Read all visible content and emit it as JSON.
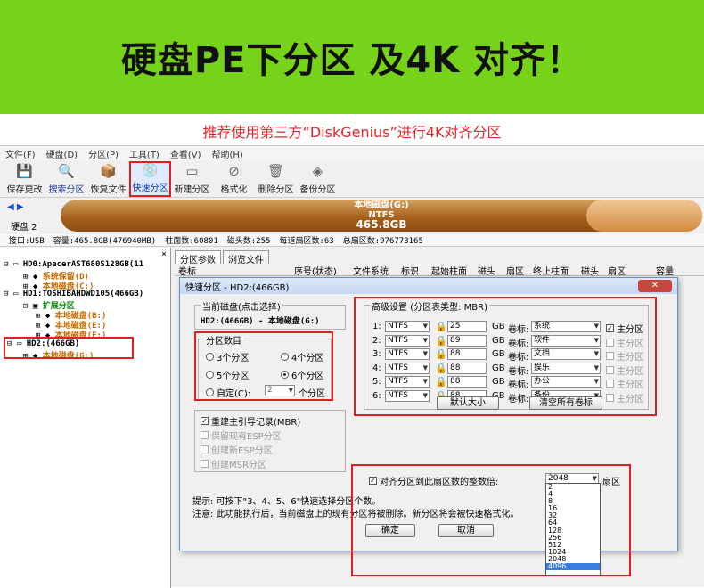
{
  "banner": {
    "title": "硬盘PE下分区 及4K 对齐！"
  },
  "subtitle": "推荐使用第三方“DiskGenius”进行4K对齐分区",
  "menu": [
    "文件(F)",
    "硬盘(D)",
    "分区(P)",
    "工具(T)",
    "查看(V)",
    "帮助(H)"
  ],
  "toolbar": [
    {
      "label": "保存更改",
      "icon": "save-icon",
      "glyph": "💾"
    },
    {
      "label": "搜索分区",
      "icon": "search-icon",
      "glyph": "🔍"
    },
    {
      "label": "恢复文件",
      "icon": "restore-icon",
      "glyph": "📦"
    },
    {
      "label": "快速分区",
      "icon": "quick-partition-icon",
      "glyph": "💿"
    },
    {
      "label": "新建分区",
      "icon": "new-partition-icon",
      "glyph": "▭"
    },
    {
      "label": "格式化",
      "icon": "format-icon",
      "glyph": "⊘"
    },
    {
      "label": "删除分区",
      "icon": "delete-icon",
      "glyph": "🗑"
    },
    {
      "label": "备份分区",
      "icon": "backup-icon",
      "glyph": "◈"
    }
  ],
  "disk": {
    "nav": "◀ ▶",
    "label": "硬盘 2",
    "vol_name": "本地磁盘(G:)",
    "fs": "NTFS",
    "size": "465.8GB"
  },
  "info": {
    "iface": "接口:USB",
    "capacity": "容量:465.8GB(476940MB)",
    "cylinders": "柱面数:60801",
    "heads": "磁头数:255",
    "sectors": "每道扇区数:63",
    "total": "总扇区数:976773165"
  },
  "tree": {
    "close": "×",
    "hd0": "HD0:ApacerAST680S128GB(11",
    "hd0_p1": "系统保留(D)",
    "hd0_p2": "本地磁盘(C:)",
    "hd1": "HD1:TOSHIBAHDWD105(466GB)",
    "hd1_ext": "扩展分区",
    "hd1_p1": "本地磁盘(B:)",
    "hd1_p2": "本地磁盘(E:)",
    "hd1_p3": "本地磁盘(F:)",
    "hd2": "HD2:(466GB)",
    "hd2_p1": "本地磁盘(G:)"
  },
  "tabs": [
    "分区参数",
    "浏览文件"
  ],
  "columns": [
    "卷标",
    "序号(状态)",
    "文件系统",
    "标识",
    "起始柱面",
    "磁头",
    "扇区",
    "终止柱面",
    "磁头",
    "扇区",
    "容量"
  ],
  "dialog": {
    "title": "快速分区 - HD2:(466GB)",
    "close": "✕",
    "current_disk_label": "当前磁盘(点击选择)",
    "current_disk": "HD2:(466GB) - 本地磁盘(G:)",
    "count_group": "分区数目",
    "opt3": "3个分区",
    "opt4": "4个分区",
    "opt5": "5个分区",
    "opt6": "6个分区",
    "custom": "自定(C):",
    "custom_value": "2",
    "custom_unit": "个分区",
    "rebuild_mbr": "重建主引导记录(MBR)",
    "keep_esp": "保留现有ESP分区",
    "new_esp": "创建新ESP分区",
    "new_msr": "创建MSR分区",
    "adv_group": "高级设置 (分区表类型: MBR)",
    "unit": "GB",
    "vol_label": "卷标:",
    "primary": "主分区",
    "rows": [
      {
        "no": "1:",
        "fs": "NTFS",
        "size": "25",
        "label": "系统",
        "primary": true
      },
      {
        "no": "2:",
        "fs": "NTFS",
        "size": "89",
        "label": "软件",
        "primary": false
      },
      {
        "no": "3:",
        "fs": "NTFS",
        "size": "88",
        "label": "文档",
        "primary": false
      },
      {
        "no": "4:",
        "fs": "NTFS",
        "size": "88",
        "label": "娱乐",
        "primary": false
      },
      {
        "no": "5:",
        "fs": "NTFS",
        "size": "88",
        "label": "办公",
        "primary": false
      },
      {
        "no": "6:",
        "fs": "NTFS",
        "size": "88",
        "label": "备份",
        "primary": false
      }
    ],
    "default_size_btn": "默认大小",
    "clear_labels_btn": "清空所有卷标",
    "align_label": "对齐分区到此扇区数的整数倍:",
    "align_value": "2048",
    "align_unit": "扇区",
    "align_options": [
      "2",
      "4",
      "8",
      "16",
      "32",
      "64",
      "128",
      "256",
      "512",
      "1024",
      "2048",
      "4096"
    ],
    "tip1": "提示: 可按下\"3、4、5、6\"快速选择分区个数。",
    "tip2": "注意: 此功能执行后，当前磁盘上的现有分区将被删除。新分区将会被快速格式化。",
    "ok_btn": "确定",
    "cancel_btn": "取消"
  },
  "colors": {
    "banner": "#77d31a",
    "accent_red": "#e02020",
    "subtitle_red": "#e0262a"
  }
}
